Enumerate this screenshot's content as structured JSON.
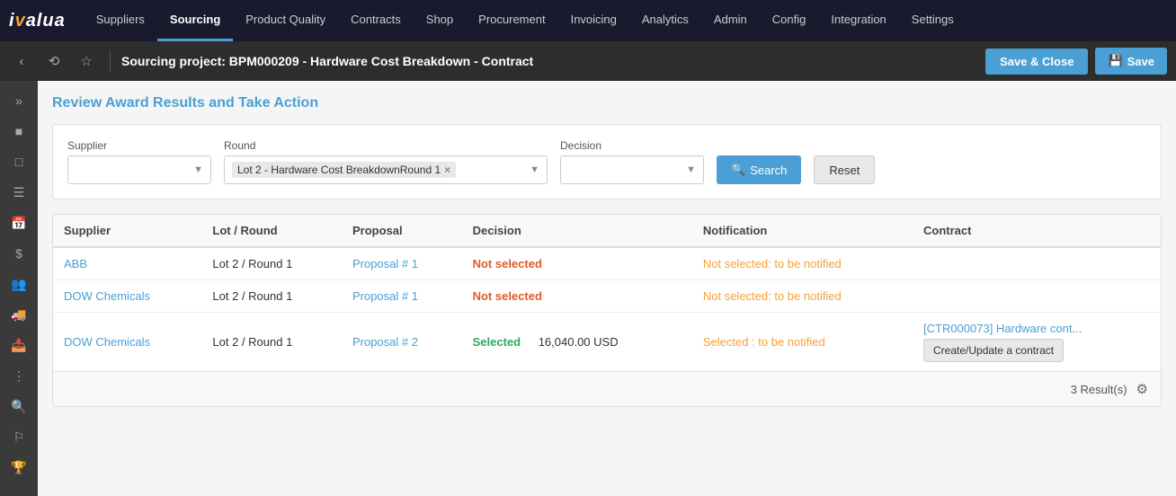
{
  "nav": {
    "logo": "ivalua",
    "items": [
      {
        "label": "Suppliers",
        "active": false
      },
      {
        "label": "Sourcing",
        "active": true
      },
      {
        "label": "Product Quality",
        "active": false
      },
      {
        "label": "Contracts",
        "active": false
      },
      {
        "label": "Shop",
        "active": false
      },
      {
        "label": "Procurement",
        "active": false
      },
      {
        "label": "Invoicing",
        "active": false
      },
      {
        "label": "Analytics",
        "active": false
      },
      {
        "label": "Admin",
        "active": false
      },
      {
        "label": "Config",
        "active": false
      },
      {
        "label": "Integration",
        "active": false
      },
      {
        "label": "Settings",
        "active": false
      }
    ]
  },
  "secondary": {
    "page_title": "Sourcing project: BPM000209 - Hardware Cost Breakdown - Contract",
    "save_close_label": "Save & Close",
    "save_label": "Save"
  },
  "section": {
    "title": "Review Award Results and Take Action"
  },
  "filters": {
    "supplier_label": "Supplier",
    "supplier_placeholder": "",
    "round_label": "Round",
    "round_value": "Lot 2 - Hardware Cost BreakdownRound 1",
    "decision_label": "Decision",
    "decision_placeholder": "",
    "search_label": "Search",
    "reset_label": "Reset"
  },
  "table": {
    "columns": [
      "Supplier",
      "Lot / Round",
      "Proposal",
      "Decision",
      "Notification",
      "Contract"
    ],
    "rows": [
      {
        "supplier": "ABB",
        "lot_round": "Lot 2 / Round 1",
        "proposal": "Proposal # 1",
        "decision": "Not selected",
        "decision_status": "not_selected",
        "amount": "",
        "notification": "Not selected: to be notified",
        "notification_status": "orange",
        "contract_link": "",
        "contract_btn": ""
      },
      {
        "supplier": "DOW Chemicals",
        "lot_round": "Lot 2 / Round 1",
        "proposal": "Proposal # 1",
        "decision": "Not selected",
        "decision_status": "not_selected",
        "amount": "",
        "notification": "Not selected: to be notified",
        "notification_status": "orange",
        "contract_link": "",
        "contract_btn": ""
      },
      {
        "supplier": "DOW Chemicals",
        "lot_round": "Lot 2 / Round 1",
        "proposal": "Proposal # 2",
        "decision": "Selected",
        "decision_status": "selected",
        "amount": "16,040.00 USD",
        "notification": "Selected : to be notified",
        "notification_status": "orange",
        "contract_link": "[CTR000073] Hardware cont...",
        "contract_btn": "Create/Update a contract"
      }
    ],
    "footer": {
      "results_count": "3 Result(s)"
    }
  }
}
